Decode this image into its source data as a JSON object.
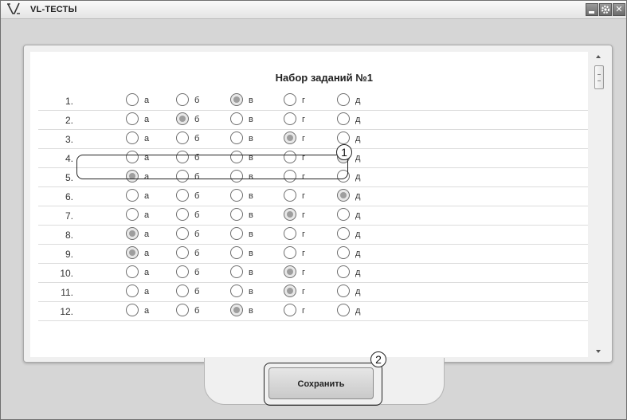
{
  "window": {
    "title": "VL-ТЕСТЫ",
    "logo": "V"
  },
  "titlebar_buttons": [
    "minimize-icon",
    "gear-icon",
    "close-icon"
  ],
  "heading": "Набор заданий №1",
  "option_labels": [
    "а",
    "б",
    "в",
    "г",
    "д"
  ],
  "rows": [
    {
      "num": "1.",
      "selected": 2
    },
    {
      "num": "2.",
      "selected": 1
    },
    {
      "num": "3.",
      "selected": 3
    },
    {
      "num": "4.",
      "selected": 4
    },
    {
      "num": "5.",
      "selected": 0
    },
    {
      "num": "6.",
      "selected": 4
    },
    {
      "num": "7.",
      "selected": 3
    },
    {
      "num": "8.",
      "selected": 0
    },
    {
      "num": "9.",
      "selected": 0
    },
    {
      "num": "10.",
      "selected": 3
    },
    {
      "num": "11.",
      "selected": 3
    },
    {
      "num": "12.",
      "selected": 2
    }
  ],
  "save_label": "Сохранить",
  "callouts": [
    "1",
    "2"
  ]
}
